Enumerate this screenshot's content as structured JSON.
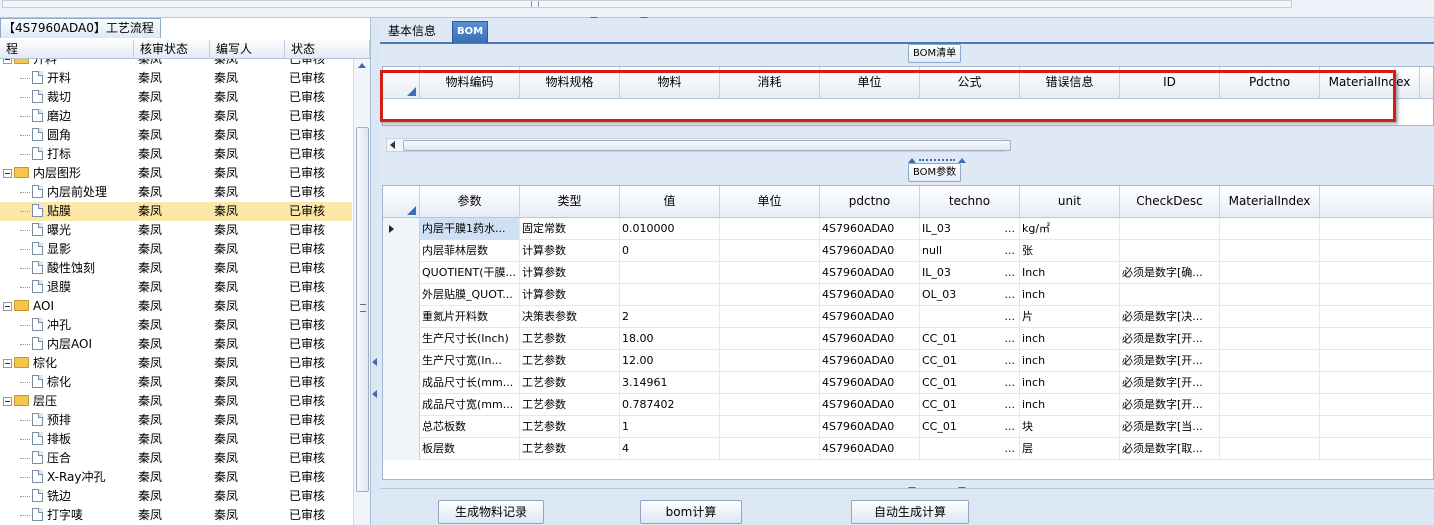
{
  "left_panel": {
    "tab_title": "【4S7960ADA0】工艺流程",
    "columns": [
      "程",
      "核审状态",
      "编写人",
      "状态"
    ],
    "rows": [
      {
        "kind": "folder",
        "name": "开料",
        "reviewer_status": "秦凤",
        "author": "秦凤",
        "status": "已审核",
        "partial": true
      },
      {
        "kind": "doc",
        "name": "开料",
        "reviewer_status": "秦凤",
        "author": "秦凤",
        "status": "已审核"
      },
      {
        "kind": "doc",
        "name": "裁切",
        "reviewer_status": "秦凤",
        "author": "秦凤",
        "status": "已审核"
      },
      {
        "kind": "doc",
        "name": "磨边",
        "reviewer_status": "秦凤",
        "author": "秦凤",
        "status": "已审核"
      },
      {
        "kind": "doc",
        "name": "圆角",
        "reviewer_status": "秦凤",
        "author": "秦凤",
        "status": "已审核"
      },
      {
        "kind": "doc",
        "name": "打标",
        "reviewer_status": "秦凤",
        "author": "秦凤",
        "status": "已审核"
      },
      {
        "kind": "folder",
        "name": "内层图形",
        "reviewer_status": "秦凤",
        "author": "秦凤",
        "status": "已审核"
      },
      {
        "kind": "doc",
        "name": "内层前处理",
        "reviewer_status": "秦凤",
        "author": "秦凤",
        "status": "已审核"
      },
      {
        "kind": "doc",
        "name": "贴膜",
        "reviewer_status": "秦凤",
        "author": "秦凤",
        "status": "已审核",
        "selected": true
      },
      {
        "kind": "doc",
        "name": "曝光",
        "reviewer_status": "秦凤",
        "author": "秦凤",
        "status": "已审核"
      },
      {
        "kind": "doc",
        "name": "显影",
        "reviewer_status": "秦凤",
        "author": "秦凤",
        "status": "已审核"
      },
      {
        "kind": "doc",
        "name": "酸性蚀刻",
        "reviewer_status": "秦凤",
        "author": "秦凤",
        "status": "已审核"
      },
      {
        "kind": "doc",
        "name": "退膜",
        "reviewer_status": "秦凤",
        "author": "秦凤",
        "status": "已审核"
      },
      {
        "kind": "folder",
        "name": "AOI",
        "reviewer_status": "秦凤",
        "author": "秦凤",
        "status": "已审核"
      },
      {
        "kind": "doc",
        "name": "冲孔",
        "reviewer_status": "秦凤",
        "author": "秦凤",
        "status": "已审核"
      },
      {
        "kind": "doc",
        "name": "内层AOI",
        "reviewer_status": "秦凤",
        "author": "秦凤",
        "status": "已审核"
      },
      {
        "kind": "folder",
        "name": "棕化",
        "reviewer_status": "秦凤",
        "author": "秦凤",
        "status": "已审核"
      },
      {
        "kind": "doc",
        "name": "棕化",
        "reviewer_status": "秦凤",
        "author": "秦凤",
        "status": "已审核"
      },
      {
        "kind": "folder",
        "name": "层压",
        "reviewer_status": "秦凤",
        "author": "秦凤",
        "status": "已审核"
      },
      {
        "kind": "doc",
        "name": "预排",
        "reviewer_status": "秦凤",
        "author": "秦凤",
        "status": "已审核"
      },
      {
        "kind": "doc",
        "name": "排板",
        "reviewer_status": "秦凤",
        "author": "秦凤",
        "status": "已审核"
      },
      {
        "kind": "doc",
        "name": "压合",
        "reviewer_status": "秦凤",
        "author": "秦凤",
        "status": "已审核"
      },
      {
        "kind": "doc",
        "name": "X-Ray冲孔",
        "reviewer_status": "秦凤",
        "author": "秦凤",
        "status": "已审核"
      },
      {
        "kind": "doc",
        "name": "铣边",
        "reviewer_status": "秦凤",
        "author": "秦凤",
        "status": "已审核"
      },
      {
        "kind": "doc",
        "name": "打字唛",
        "reviewer_status": "秦凤",
        "author": "秦凤",
        "status": "已审核"
      }
    ]
  },
  "right_panel": {
    "tabs": [
      "基本信息",
      "BOM"
    ],
    "active_tab": "BOM",
    "bom_list": {
      "title": "BOM清单",
      "columns": [
        "物料编码",
        "物料规格",
        "物料",
        "消耗",
        "单位",
        "公式",
        "错误信息",
        "ID",
        "Pdctno",
        "MaterialIndex"
      ]
    },
    "bom_params": {
      "title": "BOM参数",
      "columns": [
        "参数",
        "类型",
        "值",
        "单位",
        "pdctno",
        "techno",
        "unit",
        "CheckDesc",
        "MaterialIndex"
      ],
      "rows": [
        [
          "内层干膜1药水...",
          "固定常数",
          "0.010000",
          "",
          "4S7960ADA0",
          "IL_03",
          "kg/㎡",
          "",
          ""
        ],
        [
          "内层菲林层数",
          "计算参数",
          "0",
          "",
          "4S7960ADA0",
          "null",
          "张",
          "",
          ""
        ],
        [
          "QUOTIENT(干膜...",
          "计算参数",
          "",
          "",
          "4S7960ADA0",
          "IL_03",
          "Inch",
          "必须是数字[确...",
          ""
        ],
        [
          "外层贴膜_QUOT...",
          "计算参数",
          "",
          "",
          "4S7960ADA0",
          "OL_03",
          "inch",
          "",
          ""
        ],
        [
          "重氮片开料数",
          "决策表参数",
          "2",
          "",
          "4S7960ADA0",
          "",
          "片",
          "必须是数字[决...",
          ""
        ],
        [
          "生产尺寸长(Inch)",
          "工艺参数",
          "18.00",
          "",
          "4S7960ADA0",
          "CC_01",
          "inch",
          "必须是数字[开...",
          ""
        ],
        [
          "生产尺寸宽(In...",
          "工艺参数",
          "12.00",
          "",
          "4S7960ADA0",
          "CC_01",
          "inch",
          "必须是数字[开...",
          ""
        ],
        [
          "成品尺寸长(mm...",
          "工艺参数",
          "3.14961",
          "",
          "4S7960ADA0",
          "CC_01",
          "inch",
          "必须是数字[开...",
          ""
        ],
        [
          "成品尺寸宽(mm...",
          "工艺参数",
          "0.787402",
          "",
          "4S7960ADA0",
          "CC_01",
          "inch",
          "必须是数字[开...",
          ""
        ],
        [
          "总芯板数",
          "工艺参数",
          "1",
          "",
          "4S7960ADA0",
          "CC_01",
          "块",
          "必须是数字[当...",
          ""
        ],
        [
          "板层数",
          "工艺参数",
          "4",
          "",
          "4S7960ADA0",
          "",
          "层",
          "必须是数字[取...",
          ""
        ]
      ],
      "ellipsis": "..."
    },
    "buttons": {
      "generate_material": "生成物料记录",
      "bom_calc": "bom计算",
      "auto_calc": "自动生成计算"
    }
  },
  "colors": {
    "accent": "#3d6fb0",
    "selected_row": "#fbe7a6",
    "highlight_box": "#d41c1c"
  }
}
